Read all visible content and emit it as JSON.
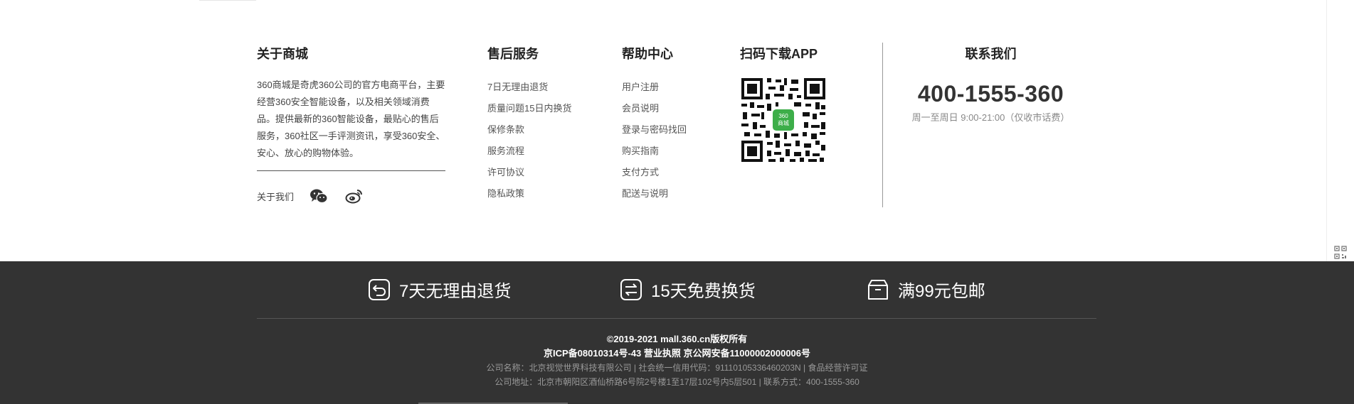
{
  "about": {
    "title": "关于商城",
    "description": "360商城是奇虎360公司的官方电商平台，主要经营360安全智能设备，以及相关领域消费品。提供最新的360智能设备，最贴心的售后服务，360社区一手评测资讯，享受360安全、安心、放心的购物体验。",
    "follow_label": "关于我们",
    "icons": [
      "wechat-icon",
      "weibo-icon"
    ]
  },
  "after_sale": {
    "title": "售后服务",
    "links": [
      "7日无理由退货",
      "质量问题15日内换货",
      "保修条款",
      "服务流程",
      "许可协议",
      "隐私政策"
    ]
  },
  "help": {
    "title": "帮助中心",
    "links": [
      "用户注册",
      "会员说明",
      "登录与密码找回",
      "购买指南",
      "支付方式",
      "配送与说明"
    ]
  },
  "app": {
    "title": "扫码下载APP",
    "qr_badge_top": "360",
    "qr_badge_bottom": "商城"
  },
  "contact": {
    "title": "联系我们",
    "phone": "400-1555-360",
    "hours": "周一至周日 9:00-21:00（仅收市话费）"
  },
  "promises": [
    {
      "icon": "return-icon",
      "label": "7天无理由退货"
    },
    {
      "icon": "exchange-icon",
      "label": "15天免费换货"
    },
    {
      "icon": "box-icon",
      "label": "满99元包邮"
    }
  ],
  "legal": {
    "copyright": "©2019-2021 mall.360.cn版权所有",
    "icp": "京ICP备08010314号-43 营业执照 京公网安备11000002000006号",
    "company": "公司名称：北京视觉世界科技有限公司 | 社会统一信用代码：91110105336460203N | 食品经营许可证",
    "address": "公司地址：北京市朝阳区酒仙桥路6号院2号楼1至17层102号内5层501 | 联系方式：400-1555-360"
  },
  "colors": {
    "footer_bg": "#333333",
    "qr_badge": "#3dae49"
  }
}
